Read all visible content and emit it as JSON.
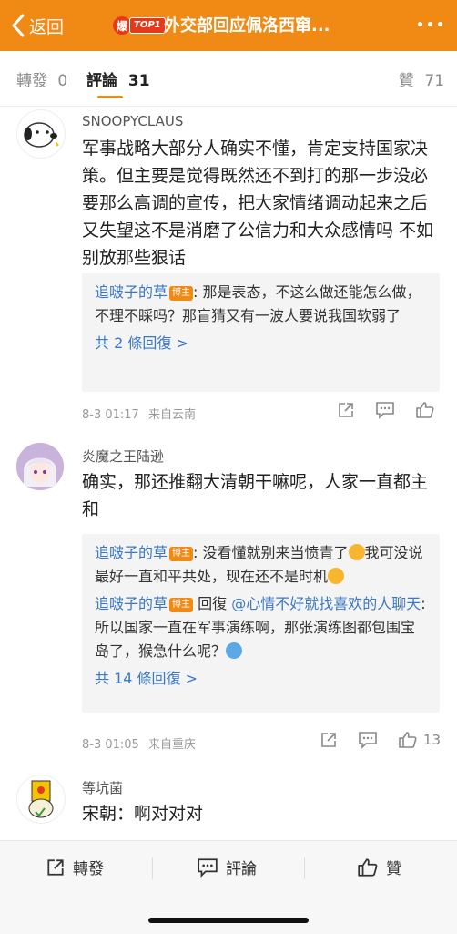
{
  "header": {
    "back_label": "返回",
    "badge_char": "爆",
    "badge_top": "TOP1",
    "title": "外交部回应佩洛西窜...",
    "more_icon": "more-dots-icon",
    "bg_color": "#f08a14"
  },
  "tabs": [
    {
      "label": "轉發",
      "count": "0"
    },
    {
      "label": "評論",
      "count": "31"
    },
    {
      "label": "贊",
      "count": "71"
    }
  ],
  "comments": [
    {
      "username": "SNOOPYCLAUS",
      "text": "军事战略大部分人确实不懂，肯定支持国家决策。但主要是觉得既然还不到打的那一步没必要那么高调的宣传，把大家情绪调动起来之后又失望这不是消磨了公信力和大众感情吗 不如别放那些狠话",
      "replies": [
        {
          "name": "追啵子的草",
          "role": "博主",
          "text": ": 那是表态，不这么做还能怎么做，不理不睬吗？那盲猜又有一波人要说我国软弱了"
        }
      ],
      "more_replies": "共 2 條回復 >",
      "time": "8-3 01:17",
      "location": "来自云南",
      "likes": ""
    },
    {
      "username": "炎魔之王陆逊",
      "text": "确实，那还推翻大清朝干嘛呢，人家一直都主和",
      "replies": [
        {
          "name": "追啵子的草",
          "role": "博主",
          "text": ": 没看懂就别来当愤青了",
          "text2": "我可没说最好一直和平共处，现在还不是时机"
        },
        {
          "name": "追啵子的草",
          "role": "博主",
          "reply_word": "回復",
          "mention": "@心情不好就找喜欢的人聊天",
          "text": ":所以国家一直在军事演练啊，那张演练图都包围宝岛了，猴急什么呢？"
        }
      ],
      "more_replies": "共 14 條回復 >",
      "time": "8-3 01:05",
      "location": "来自重庆",
      "likes": "13"
    },
    {
      "username": "等坑菌",
      "text": "宋朝：啊对对对"
    }
  ],
  "bottom_bar": {
    "repost": "轉發",
    "comment": "評論",
    "like": "贊"
  }
}
